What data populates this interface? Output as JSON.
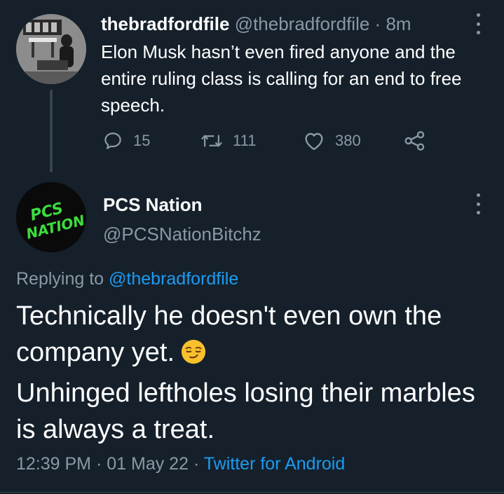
{
  "tweet1": {
    "display_name": "thebradfordfile",
    "handle": "@thebradfordfile",
    "separator": "·",
    "time_ago": "8m",
    "text": "Elon Musk hasn’t even fired anyone and the entire ruling class is calling for an end to free speech.",
    "reply_count": "15",
    "retweet_count": "111",
    "like_count": "380"
  },
  "tweet2": {
    "display_name": "PCS Nation",
    "handle": "@PCSNationBitchz",
    "avatar_text": "PCS NATION",
    "replying_prefix": "Replying to",
    "replying_to": "@thebradfordfile",
    "text_line1": "Technically he doesn't even own the company yet.",
    "text_line2": "Unhinged leftholes losing their marbles is always a treat.",
    "time": "12:39 PM",
    "separator1": "·",
    "date": "01 May 22",
    "separator2": "·",
    "source": "Twitter for Android"
  },
  "icons": {
    "reply": "reply-icon",
    "retweet": "retweet-icon",
    "like": "heart-icon",
    "share": "share-icon",
    "more": "more-options-icon",
    "emoji": "smirking-face-emoji"
  },
  "colors": {
    "background": "#15202b",
    "text": "#ffffff",
    "muted": "#8b98a5",
    "link": "#1d9bf0",
    "avatar_text_green": "#3ddc3d"
  }
}
